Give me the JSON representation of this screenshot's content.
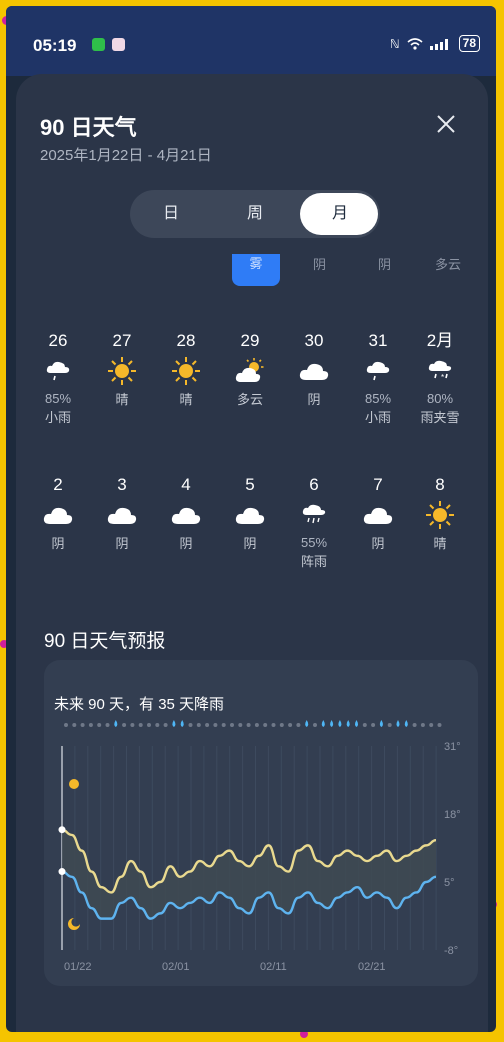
{
  "status_bar": {
    "time": "05:19",
    "battery": "78"
  },
  "header": {
    "title": "90 日天气",
    "date_range": "2025年1月22日 - 4月21日"
  },
  "segments": {
    "day": "日",
    "week": "周",
    "month": "月",
    "active": "月"
  },
  "prev_row_labels": [
    "雾",
    "阴",
    "阴",
    "多云"
  ],
  "week1": [
    {
      "day": "26",
      "icon": "rain-cloud-icon",
      "pct": "85%",
      "label": "小雨"
    },
    {
      "day": "27",
      "icon": "sun-icon",
      "pct": "",
      "label": "晴"
    },
    {
      "day": "28",
      "icon": "sun-icon",
      "pct": "",
      "label": "晴"
    },
    {
      "day": "29",
      "icon": "partly-cloudy-icon",
      "pct": "",
      "label": "多云"
    },
    {
      "day": "30",
      "icon": "cloud-icon",
      "pct": "",
      "label": "阴"
    },
    {
      "day": "31",
      "icon": "rain-cloud-icon",
      "pct": "85%",
      "label": "小雨"
    },
    {
      "day": "2月",
      "icon": "sleet-icon",
      "pct": "80%",
      "label": "雨夹雪"
    }
  ],
  "week2": [
    {
      "day": "2",
      "icon": "cloud-icon",
      "pct": "",
      "label": "阴"
    },
    {
      "day": "3",
      "icon": "cloud-icon",
      "pct": "",
      "label": "阴"
    },
    {
      "day": "4",
      "icon": "cloud-icon",
      "pct": "",
      "label": "阴"
    },
    {
      "day": "5",
      "icon": "cloud-icon",
      "pct": "",
      "label": "阴"
    },
    {
      "day": "6",
      "icon": "shower-icon",
      "pct": "55%",
      "label": "阵雨"
    },
    {
      "day": "7",
      "icon": "cloud-icon",
      "pct": "",
      "label": "阴"
    },
    {
      "day": "8",
      "icon": "sun-icon",
      "pct": "",
      "label": "晴"
    }
  ],
  "forecast": {
    "section_title": "90 日天气预报",
    "summary": "未来 90 天，有 35 天降雨"
  },
  "colors": {
    "accent": "#2f7cf6",
    "high_line": "#e9d98f",
    "low_line": "#5eb3ef",
    "rain_drop": "#4fb6f5"
  },
  "chart_data": {
    "type": "line",
    "title": "未来 90 天，有 35 天降雨",
    "x_tick_labels": [
      "01/22",
      "02/01",
      "02/11",
      "02/21"
    ],
    "y_tick_labels": [
      "31°",
      "18°",
      "5°",
      "-8°"
    ],
    "ylim": [
      -8,
      31
    ],
    "x": [
      0,
      1,
      2,
      3,
      4,
      5,
      6,
      7,
      8,
      9,
      10,
      11,
      12,
      13,
      14,
      15,
      16,
      17,
      18,
      19,
      20,
      21,
      22,
      23,
      24,
      25,
      26,
      27,
      28,
      29,
      30,
      31,
      32,
      33,
      34,
      35,
      36,
      37,
      38
    ],
    "series": [
      {
        "values": [
          15,
          14,
          11,
          7,
          4,
          3,
          6,
          9,
          7,
          4,
          5,
          8,
          6,
          7,
          9,
          8,
          10,
          11,
          9,
          8,
          10,
          12,
          8,
          7,
          11,
          12,
          9,
          8,
          10,
          11,
          10,
          9,
          10,
          11,
          9,
          10,
          11,
          12,
          13
        ]
      },
      {
        "values": [
          7,
          6,
          3,
          0,
          -2,
          -2,
          1,
          2,
          0,
          -2,
          -1,
          1,
          0,
          1,
          2,
          1,
          3,
          2,
          0,
          -1,
          2,
          3,
          0,
          -1,
          2,
          3,
          1,
          0,
          2,
          3,
          4,
          2,
          3,
          2,
          0,
          2,
          3,
          5,
          6
        ]
      }
    ],
    "rain_days": [
      0,
      0,
      0,
      0,
      0,
      0,
      1,
      0,
      0,
      0,
      0,
      0,
      0,
      1,
      1,
      0,
      0,
      0,
      0,
      0,
      0,
      0,
      0,
      0,
      0,
      0,
      0,
      0,
      0,
      1,
      0,
      1,
      1,
      1,
      1,
      1,
      0,
      0,
      1,
      0,
      1,
      1,
      0,
      0,
      0,
      0
    ],
    "grid": true
  }
}
